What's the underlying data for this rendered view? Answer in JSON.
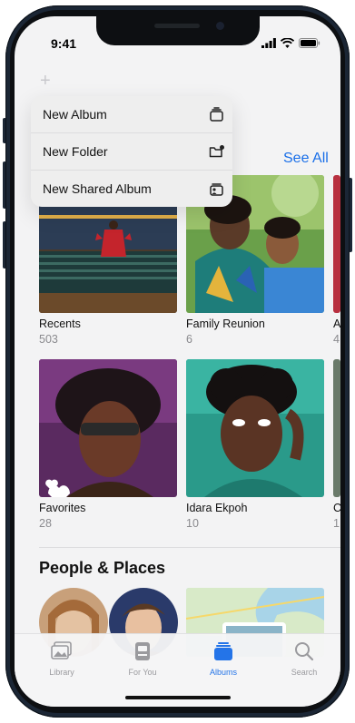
{
  "status_bar": {
    "time": "9:41"
  },
  "header": {
    "see_all": "See All"
  },
  "menu": {
    "items": [
      {
        "label": "New Album",
        "icon": "album-stack-icon"
      },
      {
        "label": "New Folder",
        "icon": "folder-add-icon"
      },
      {
        "label": "New Shared Album",
        "icon": "shared-album-icon"
      }
    ]
  },
  "albums": {
    "items": [
      {
        "name": "Recents",
        "count": "503"
      },
      {
        "name": "Family Reunion",
        "count": "6"
      },
      {
        "name": "A",
        "count": "4"
      },
      {
        "name": "Favorites",
        "count": "28"
      },
      {
        "name": "Idara Ekpoh",
        "count": "10"
      },
      {
        "name": "C",
        "count": "1"
      }
    ]
  },
  "people_places": {
    "title": "People & Places"
  },
  "tabbar": {
    "tabs": [
      {
        "label": "Library",
        "icon": "photo-library-icon"
      },
      {
        "label": "For You",
        "icon": "for-you-icon"
      },
      {
        "label": "Albums",
        "icon": "albums-icon",
        "active": true
      },
      {
        "label": "Search",
        "icon": "search-icon"
      }
    ]
  },
  "colors": {
    "accent": "#1a6fe8",
    "frame": "#1b2635"
  }
}
